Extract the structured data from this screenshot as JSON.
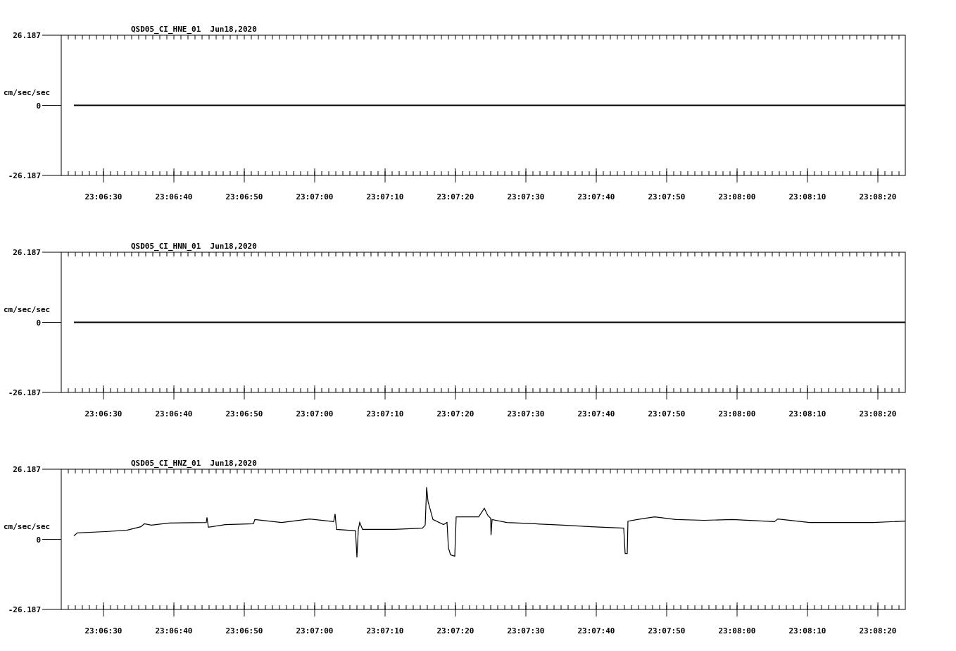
{
  "charts": [
    {
      "chart_data": {
        "type": "line",
        "title": "QSD05_CI_HNE_01  Jun18,2020",
        "ylabel": "cm/sec/sec",
        "xlim": [
          83184,
          83303.9
        ],
        "ylim": [
          -26.187,
          26.187
        ],
        "yticks": [
          26.187,
          0,
          -26.187
        ],
        "xticks": [
          {
            "value": 83190,
            "label": "23:06:30"
          },
          {
            "value": 83200,
            "label": "23:06:40"
          },
          {
            "value": 83210,
            "label": "23:06:50"
          },
          {
            "value": 83220,
            "label": "23:07:00"
          },
          {
            "value": 83230,
            "label": "23:07:10"
          },
          {
            "value": 83240,
            "label": "23:07:20"
          },
          {
            "value": 83250,
            "label": "23:07:30"
          },
          {
            "value": 83260,
            "label": "23:07:40"
          },
          {
            "value": 83270,
            "label": "23:07:50"
          },
          {
            "value": 83280,
            "label": "23:08:00"
          },
          {
            "value": 83290,
            "label": "23:08:10"
          },
          {
            "value": 83300,
            "label": "23:08:20"
          }
        ],
        "x": [
          83185.8,
          83303.9
        ],
        "series": [
          {
            "color": "#000000",
            "values": [
              0,
              0
            ]
          }
        ]
      }
    },
    {
      "chart_data": {
        "type": "line",
        "title": "QSD05_CI_HNN_01  Jun18,2020",
        "ylabel": "cm/sec/sec",
        "xlim": [
          83184,
          83303.9
        ],
        "ylim": [
          -26.187,
          26.187
        ],
        "yticks": [
          26.187,
          0,
          -26.187
        ],
        "xticks": [
          {
            "value": 83190,
            "label": "23:06:30"
          },
          {
            "value": 83200,
            "label": "23:06:40"
          },
          {
            "value": 83210,
            "label": "23:06:50"
          },
          {
            "value": 83220,
            "label": "23:07:00"
          },
          {
            "value": 83230,
            "label": "23:07:10"
          },
          {
            "value": 83240,
            "label": "23:07:20"
          },
          {
            "value": 83250,
            "label": "23:07:30"
          },
          {
            "value": 83260,
            "label": "23:07:40"
          },
          {
            "value": 83270,
            "label": "23:07:50"
          },
          {
            "value": 83280,
            "label": "23:08:00"
          },
          {
            "value": 83290,
            "label": "23:08:10"
          },
          {
            "value": 83300,
            "label": "23:08:20"
          }
        ],
        "x": [
          83185.8,
          83303.9
        ],
        "series": [
          {
            "color": "#000000",
            "values": [
              0,
              0
            ]
          }
        ]
      }
    },
    {
      "chart_data": {
        "type": "line",
        "title": "QSD05_CI_HNZ_01  Jun18,2020",
        "ylabel": "cm/sec/sec",
        "xlim": [
          83184,
          83303.9
        ],
        "ylim": [
          -26.187,
          26.187
        ],
        "yticks": [
          26.187,
          0,
          -26.187
        ],
        "xticks": [
          {
            "value": 83190,
            "label": "23:06:30"
          },
          {
            "value": 83200,
            "label": "23:06:40"
          },
          {
            "value": 83210,
            "label": "23:06:50"
          },
          {
            "value": 83220,
            "label": "23:07:00"
          },
          {
            "value": 83230,
            "label": "23:07:10"
          },
          {
            "value": 83240,
            "label": "23:07:20"
          },
          {
            "value": 83250,
            "label": "23:07:30"
          },
          {
            "value": 83260,
            "label": "23:07:40"
          },
          {
            "value": 83270,
            "label": "23:07:50"
          },
          {
            "value": 83280,
            "label": "23:08:00"
          },
          {
            "value": 83290,
            "label": "23:08:10"
          },
          {
            "value": 83300,
            "label": "23:08:20"
          }
        ],
        "x": [
          83185.8,
          83186.3,
          83190.3,
          83193.3,
          83195.3,
          83195.8,
          83196.8,
          83199.3,
          83204.6,
          83204.7,
          83204.9,
          83207.3,
          83211.3,
          83211.5,
          83215.3,
          83219.3,
          83222.7,
          83222.9,
          83223.1,
          83225.8,
          83226,
          83226.2,
          83226.4,
          83226.8,
          83231.3,
          83235.3,
          83235.7,
          83235.9,
          83236.1,
          83236.8,
          83238.3,
          83238.8,
          83239,
          83239.3,
          83239.9,
          83240.1,
          83243.3,
          83244.1,
          83244.6,
          83245,
          83245.05,
          83245.2,
          83247.3,
          83251.3,
          83255.3,
          83259.3,
          83263.9,
          83264.1,
          83264.4,
          83264.5,
          83266.3,
          83268.3,
          83271.3,
          83275.3,
          83279.3,
          83285.3,
          83285.8,
          83290.3,
          83295.3,
          83299.3,
          83303.9
        ],
        "series": [
          {
            "color": "#000000",
            "values": [
              1.3,
              2.4,
              2.9,
              3.4,
              4.7,
              5.8,
              5.3,
              6.1,
              6.3,
              8.2,
              4.5,
              5.5,
              5.8,
              7.4,
              6.3,
              7.6,
              6.6,
              9.5,
              3.7,
              3.2,
              -6.8,
              3.7,
              6.3,
              3.7,
              3.7,
              4.2,
              5.3,
              19.5,
              14.2,
              7.4,
              5.5,
              6.3,
              -3.2,
              -5.8,
              -6.3,
              8.4,
              8.4,
              11.6,
              8.9,
              7.9,
              1.6,
              7.4,
              6.3,
              5.8,
              5.3,
              4.7,
              4.2,
              -5.3,
              -5.3,
              6.8,
              7.6,
              8.4,
              7.4,
              7.1,
              7.4,
              6.6,
              7.6,
              6.3,
              6.3,
              6.3,
              6.8
            ]
          }
        ]
      }
    }
  ]
}
